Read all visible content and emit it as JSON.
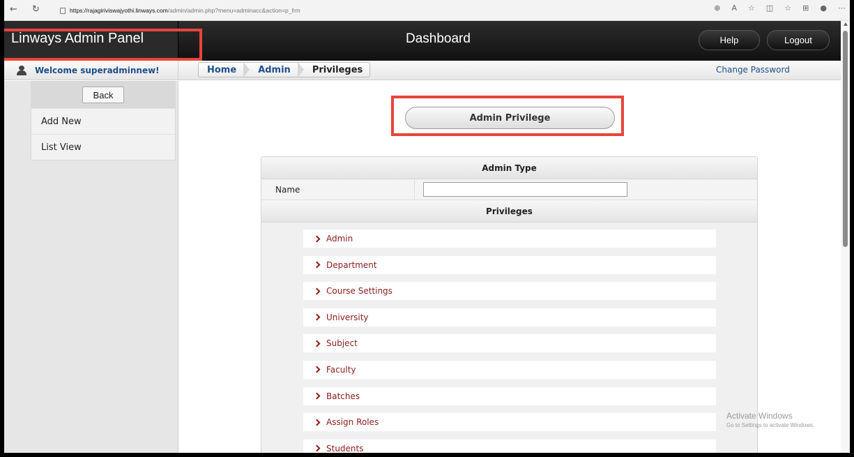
{
  "browser": {
    "url_host": "https://rajagiriviswajyothi.linways.com",
    "url_path": "/admin/admin.php?menu=adminacc&action=p_frm"
  },
  "header": {
    "brand": "Linways Admin Panel",
    "title": "Dashboard",
    "help_label": "Help",
    "logout_label": "Logout"
  },
  "subbar": {
    "welcome": "Welcome superadminnew!",
    "breadcrumb": [
      "Home",
      "Admin",
      "Privileges"
    ],
    "change_password": "Change Password"
  },
  "sidebar": {
    "back_label": "Back",
    "items": [
      "Add New",
      "List View"
    ]
  },
  "main": {
    "privilege_button": "Admin Privilege",
    "admin_type_header": "Admin Type",
    "name_label": "Name",
    "name_value": "",
    "privileges_header": "Privileges",
    "privileges": [
      "Admin",
      "Department",
      "Course Settings",
      "University",
      "Subject",
      "Faculty",
      "Batches",
      "Assign Roles",
      "Students"
    ]
  },
  "watermark": {
    "line1": "Activate Windows",
    "line2": "Go to Settings to activate Windows."
  },
  "colors": {
    "annotation": "#e8453c",
    "link": "#1d4f8a",
    "privilege_text": "#8a1c1c"
  }
}
